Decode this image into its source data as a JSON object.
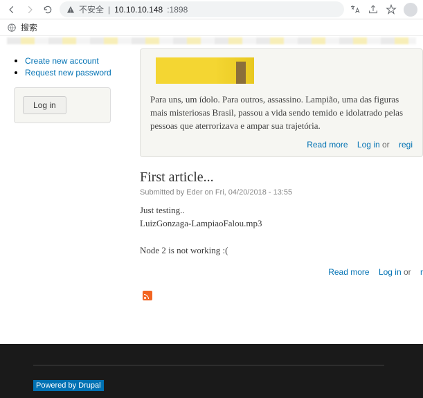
{
  "browser": {
    "insecure_label": "不安全",
    "separator": "|",
    "address": "10.10.10.148",
    "port": ":1898"
  },
  "search_label": "搜索",
  "sidebar": {
    "links": [
      {
        "label": "Create new account"
      },
      {
        "label": "Request new password"
      }
    ],
    "login_button": "Log in"
  },
  "article1": {
    "body": "Para uns, um ídolo. Para outros, assassino. Lampião, uma das figuras mais misteriosas Brasil, passou a vida sendo temido e idolatrado pelas pessoas que aterrorizava e ampar sua trajetória.",
    "read_more": "Read more",
    "login_link": "Log in",
    "or": "or",
    "register": "regi"
  },
  "article2": {
    "title": "First article...",
    "submitted": "Submitted by Eder on Fri, 04/20/2018 - 13:55",
    "line1": "Just testing..",
    "line2": "LuizGonzaga-LampiaoFalou.mp3",
    "line3": "Node 2 is not working :(",
    "read_more": "Read more",
    "login_link": "Log in",
    "or": "or",
    "register": "r"
  },
  "footer": {
    "powered": "Powered by Drupal"
  }
}
